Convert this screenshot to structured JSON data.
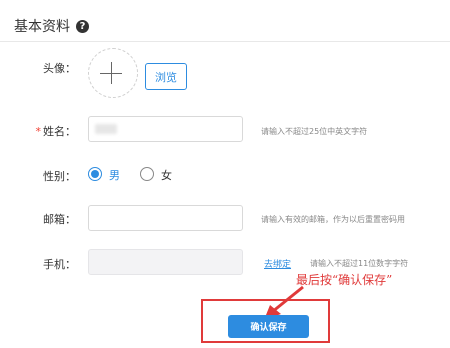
{
  "section": {
    "title": "基本资料",
    "help_icon": "question-circle-icon"
  },
  "form": {
    "avatar_label": "头像：",
    "browse_label": "浏览",
    "name_label": "姓名：",
    "name_required_mark": "*",
    "name_hint": "请输入不超过25位中英文字符",
    "gender_label": "性别：",
    "gender_options": [
      "男",
      "女"
    ],
    "gender_selected": "男",
    "email_label": "邮箱：",
    "email_value": "",
    "email_hint": "请输入有效的邮箱，作为以后重置密码用",
    "phone_label": "手机：",
    "phone_value": "",
    "unbind_label": "去绑定",
    "phone_hint": "请输入不超过11位数字字符",
    "save_label": "确认保存"
  },
  "annotation": {
    "text": "最后按“确认保存”"
  },
  "colors": {
    "accent": "#2d8ce0",
    "annotation_red": "#e03a3a",
    "required_red": "#f04134"
  }
}
